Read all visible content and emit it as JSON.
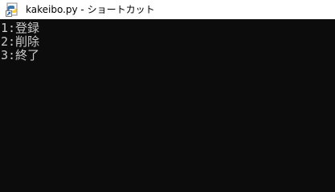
{
  "window": {
    "title": "kakeibo.py - ショートカット",
    "icon": "python-shortcut-icon"
  },
  "console": {
    "lines": [
      "1:登録",
      "2:削除",
      "3:終了"
    ]
  },
  "colors": {
    "titlebar_bg": "#ffffff",
    "console_bg": "#0c0c0c",
    "console_text": "#cccccc",
    "python_blue": "#3b77a8",
    "python_yellow": "#ffd43b"
  }
}
